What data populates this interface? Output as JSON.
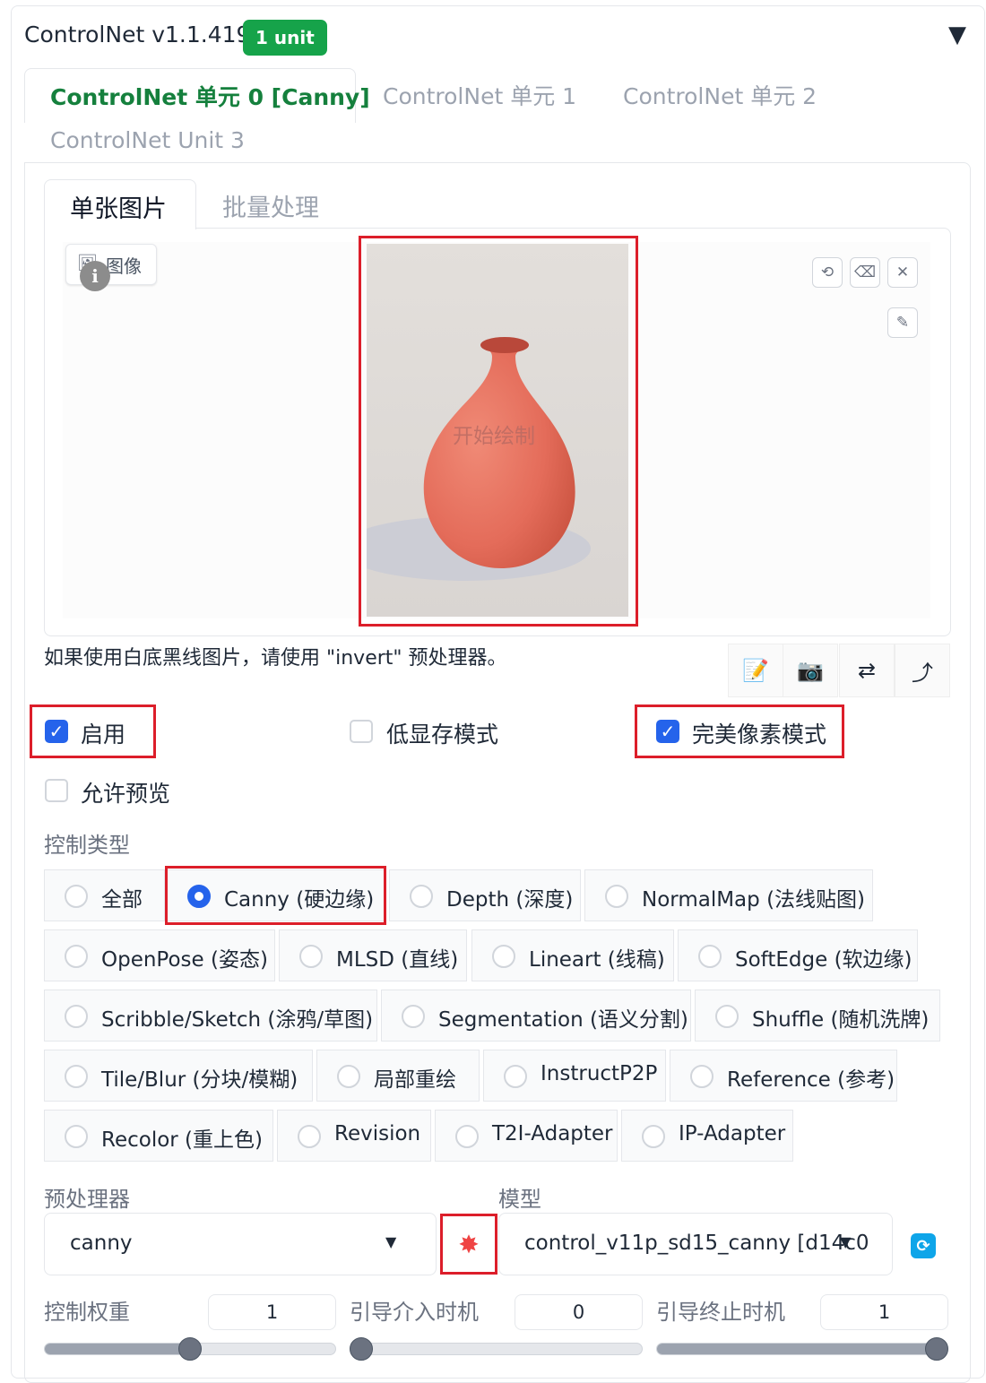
{
  "header": {
    "title": "ControlNet v1.1.419",
    "badge": "1 unit",
    "collapse_glyph": "▼"
  },
  "unit_tabs": [
    "ControlNet 单元 0 [Canny]",
    "ControlNet 单元 1",
    "ControlNet 单元 2",
    "ControlNet Unit 3"
  ],
  "image_tabs": [
    "单张图片",
    "批量处理"
  ],
  "image_area": {
    "label": "图像",
    "overlay_text": "开始绘制"
  },
  "hint_text": "如果使用白底黑线图片，请使用 \"invert\" 预处理器。",
  "options": {
    "enable": {
      "label": "启用",
      "checked": true
    },
    "low_vram": {
      "label": "低显存模式",
      "checked": false
    },
    "pixel_perfect": {
      "label": "完美像素模式",
      "checked": true
    },
    "allow_preview": {
      "label": "允许预览",
      "checked": false
    }
  },
  "control_type": {
    "label": "控制类型",
    "selected": "Canny (硬边缘)",
    "options": [
      "全部",
      "Canny (硬边缘)",
      "Depth (深度)",
      "NormalMap (法线贴图)",
      "OpenPose (姿态)",
      "MLSD (直线)",
      "Lineart (线稿)",
      "SoftEdge (软边缘)",
      "Scribble/Sketch (涂鸦/草图)",
      "Segmentation (语义分割)",
      "Shuffle (随机洗牌)",
      "Tile/Blur (分块/模糊)",
      "局部重绘",
      "InstructP2P",
      "Reference (参考)",
      "Recolor (重上色)",
      "Revision",
      "T2I-Adapter",
      "IP-Adapter"
    ]
  },
  "preprocessor": {
    "label": "预处理器",
    "value": "canny"
  },
  "model": {
    "label": "模型",
    "value": "control_v11p_sd15_canny [d14c0"
  },
  "sliders": [
    {
      "label": "控制权重",
      "value": "1",
      "fraction": 0.5
    },
    {
      "label": "引导介入时机",
      "value": "0",
      "fraction": 0.0
    },
    {
      "label": "引导终止时机",
      "value": "1",
      "fraction": 1.0
    }
  ],
  "colors": {
    "accent_green": "#15803d",
    "checkbox_blue": "#2563eb",
    "highlight_red": "#dc1e2a",
    "vase": "#e8705e"
  }
}
